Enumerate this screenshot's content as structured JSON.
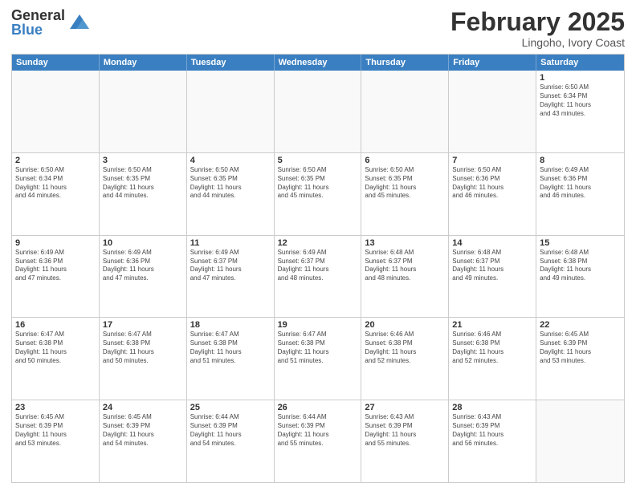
{
  "logo": {
    "general": "General",
    "blue": "Blue"
  },
  "header": {
    "month": "February 2025",
    "location": "Lingoho, Ivory Coast"
  },
  "weekdays": [
    "Sunday",
    "Monday",
    "Tuesday",
    "Wednesday",
    "Thursday",
    "Friday",
    "Saturday"
  ],
  "weeks": [
    [
      {
        "day": "",
        "info": ""
      },
      {
        "day": "",
        "info": ""
      },
      {
        "day": "",
        "info": ""
      },
      {
        "day": "",
        "info": ""
      },
      {
        "day": "",
        "info": ""
      },
      {
        "day": "",
        "info": ""
      },
      {
        "day": "1",
        "info": "Sunrise: 6:50 AM\nSunset: 6:34 PM\nDaylight: 11 hours\nand 43 minutes."
      }
    ],
    [
      {
        "day": "2",
        "info": "Sunrise: 6:50 AM\nSunset: 6:34 PM\nDaylight: 11 hours\nand 44 minutes."
      },
      {
        "day": "3",
        "info": "Sunrise: 6:50 AM\nSunset: 6:35 PM\nDaylight: 11 hours\nand 44 minutes."
      },
      {
        "day": "4",
        "info": "Sunrise: 6:50 AM\nSunset: 6:35 PM\nDaylight: 11 hours\nand 44 minutes."
      },
      {
        "day": "5",
        "info": "Sunrise: 6:50 AM\nSunset: 6:35 PM\nDaylight: 11 hours\nand 45 minutes."
      },
      {
        "day": "6",
        "info": "Sunrise: 6:50 AM\nSunset: 6:35 PM\nDaylight: 11 hours\nand 45 minutes."
      },
      {
        "day": "7",
        "info": "Sunrise: 6:50 AM\nSunset: 6:36 PM\nDaylight: 11 hours\nand 46 minutes."
      },
      {
        "day": "8",
        "info": "Sunrise: 6:49 AM\nSunset: 6:36 PM\nDaylight: 11 hours\nand 46 minutes."
      }
    ],
    [
      {
        "day": "9",
        "info": "Sunrise: 6:49 AM\nSunset: 6:36 PM\nDaylight: 11 hours\nand 47 minutes."
      },
      {
        "day": "10",
        "info": "Sunrise: 6:49 AM\nSunset: 6:36 PM\nDaylight: 11 hours\nand 47 minutes."
      },
      {
        "day": "11",
        "info": "Sunrise: 6:49 AM\nSunset: 6:37 PM\nDaylight: 11 hours\nand 47 minutes."
      },
      {
        "day": "12",
        "info": "Sunrise: 6:49 AM\nSunset: 6:37 PM\nDaylight: 11 hours\nand 48 minutes."
      },
      {
        "day": "13",
        "info": "Sunrise: 6:48 AM\nSunset: 6:37 PM\nDaylight: 11 hours\nand 48 minutes."
      },
      {
        "day": "14",
        "info": "Sunrise: 6:48 AM\nSunset: 6:37 PM\nDaylight: 11 hours\nand 49 minutes."
      },
      {
        "day": "15",
        "info": "Sunrise: 6:48 AM\nSunset: 6:38 PM\nDaylight: 11 hours\nand 49 minutes."
      }
    ],
    [
      {
        "day": "16",
        "info": "Sunrise: 6:47 AM\nSunset: 6:38 PM\nDaylight: 11 hours\nand 50 minutes."
      },
      {
        "day": "17",
        "info": "Sunrise: 6:47 AM\nSunset: 6:38 PM\nDaylight: 11 hours\nand 50 minutes."
      },
      {
        "day": "18",
        "info": "Sunrise: 6:47 AM\nSunset: 6:38 PM\nDaylight: 11 hours\nand 51 minutes."
      },
      {
        "day": "19",
        "info": "Sunrise: 6:47 AM\nSunset: 6:38 PM\nDaylight: 11 hours\nand 51 minutes."
      },
      {
        "day": "20",
        "info": "Sunrise: 6:46 AM\nSunset: 6:38 PM\nDaylight: 11 hours\nand 52 minutes."
      },
      {
        "day": "21",
        "info": "Sunrise: 6:46 AM\nSunset: 6:38 PM\nDaylight: 11 hours\nand 52 minutes."
      },
      {
        "day": "22",
        "info": "Sunrise: 6:45 AM\nSunset: 6:39 PM\nDaylight: 11 hours\nand 53 minutes."
      }
    ],
    [
      {
        "day": "23",
        "info": "Sunrise: 6:45 AM\nSunset: 6:39 PM\nDaylight: 11 hours\nand 53 minutes."
      },
      {
        "day": "24",
        "info": "Sunrise: 6:45 AM\nSunset: 6:39 PM\nDaylight: 11 hours\nand 54 minutes."
      },
      {
        "day": "25",
        "info": "Sunrise: 6:44 AM\nSunset: 6:39 PM\nDaylight: 11 hours\nand 54 minutes."
      },
      {
        "day": "26",
        "info": "Sunrise: 6:44 AM\nSunset: 6:39 PM\nDaylight: 11 hours\nand 55 minutes."
      },
      {
        "day": "27",
        "info": "Sunrise: 6:43 AM\nSunset: 6:39 PM\nDaylight: 11 hours\nand 55 minutes."
      },
      {
        "day": "28",
        "info": "Sunrise: 6:43 AM\nSunset: 6:39 PM\nDaylight: 11 hours\nand 56 minutes."
      },
      {
        "day": "",
        "info": ""
      }
    ]
  ]
}
